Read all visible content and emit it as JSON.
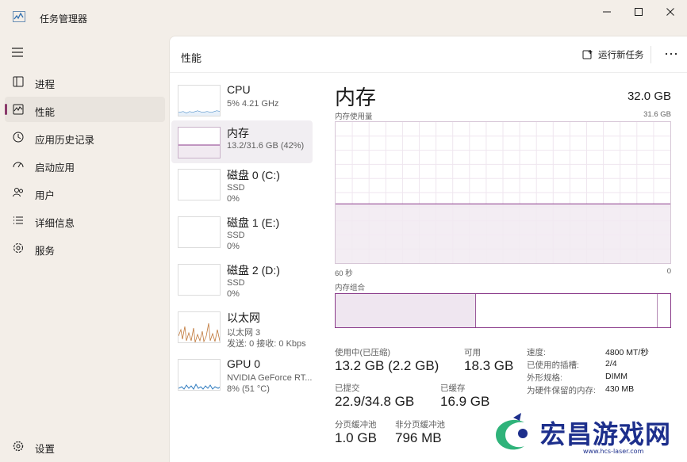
{
  "window": {
    "title": "任务管理器",
    "minimize_glyph": "—",
    "maximize_glyph": "□",
    "close_glyph": "✕"
  },
  "nav": {
    "items": [
      {
        "label": "进程",
        "icon": "processes-icon"
      },
      {
        "label": "性能",
        "icon": "performance-icon"
      },
      {
        "label": "应用历史记录",
        "icon": "app-history-icon"
      },
      {
        "label": "启动应用",
        "icon": "startup-icon"
      },
      {
        "label": "用户",
        "icon": "users-icon"
      },
      {
        "label": "详细信息",
        "icon": "details-icon"
      },
      {
        "label": "服务",
        "icon": "services-icon"
      }
    ],
    "settings_label": "设置",
    "active_index": 1
  },
  "header": {
    "page_title": "性能",
    "run_task_label": "运行新任务"
  },
  "resources": [
    {
      "name": "CPU",
      "sub1": "5%  4.21 GHz",
      "sub2": ""
    },
    {
      "name": "内存",
      "sub1": "13.2/31.6 GB (42%)",
      "sub2": ""
    },
    {
      "name": "磁盘 0 (C:)",
      "sub1": "SSD",
      "sub2": "0%"
    },
    {
      "name": "磁盘 1 (E:)",
      "sub1": "SSD",
      "sub2": "0%"
    },
    {
      "name": "磁盘 2 (D:)",
      "sub1": "SSD",
      "sub2": "0%"
    },
    {
      "name": "以太网",
      "sub1": "以太网 3",
      "sub2": "发送: 0 接收: 0 Kbps"
    },
    {
      "name": "GPU 0",
      "sub1": "NVIDIA GeForce RT...",
      "sub2": "8%  (51 °C)"
    }
  ],
  "detail": {
    "title": "内存",
    "total": "32.0 GB",
    "usage_label": "内存使用量",
    "usage_max": "31.6 GB",
    "graph_left": "60 秒",
    "graph_right": "0",
    "usage_fraction": 0.42,
    "composition_label": "内存组合",
    "composition": {
      "in_use_fraction": 0.42,
      "modified_fraction": 0.04
    },
    "stats": {
      "in_use_label": "使用中(已压缩)",
      "in_use_value": "13.2 GB (2.2 GB)",
      "available_label": "可用",
      "available_value": "18.3 GB",
      "committed_label": "已提交",
      "committed_value": "22.9/34.8 GB",
      "cached_label": "已缓存",
      "cached_value": "16.9 GB",
      "paged_label": "分页缓冲池",
      "paged_value": "1.0 GB",
      "nonpaged_label": "非分页缓冲池",
      "nonpaged_value": "796 MB"
    },
    "specs": [
      {
        "key": "速度:",
        "value": "4800 MT/秒"
      },
      {
        "key": "已使用的插槽:",
        "value": "2/4"
      },
      {
        "key": "外形规格:",
        "value": "DIMM"
      },
      {
        "key": "为硬件保留的内存:",
        "value": "430 MB"
      }
    ]
  },
  "watermark": {
    "text": "宏昌游戏网",
    "url": "www.hcs-laser.com"
  },
  "colors": {
    "accent": "#8a3a6b",
    "memory_line": "#8b3a8b",
    "memory_fill": "#f1eaf1",
    "watermark": "#1d2f8c"
  }
}
